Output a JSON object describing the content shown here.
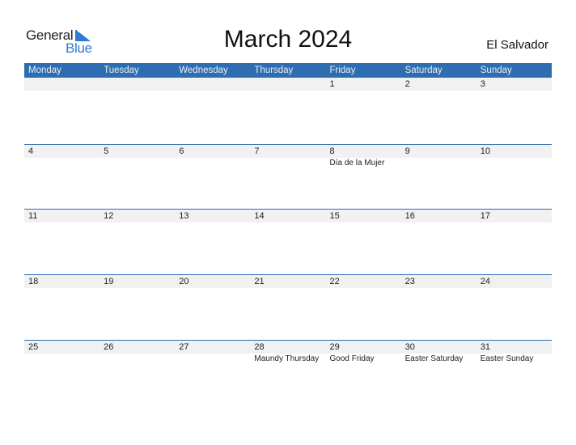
{
  "logo": {
    "line1": "General",
    "line2": "Blue",
    "brand_color": "#2e7bd0"
  },
  "title": "March 2024",
  "country": "El Salvador",
  "header_color": "#2e6db0",
  "weekdays": [
    "Monday",
    "Tuesday",
    "Wednesday",
    "Thursday",
    "Friday",
    "Saturday",
    "Sunday"
  ],
  "weeks": [
    {
      "days": [
        {
          "num": "",
          "holiday": ""
        },
        {
          "num": "",
          "holiday": ""
        },
        {
          "num": "",
          "holiday": ""
        },
        {
          "num": "",
          "holiday": ""
        },
        {
          "num": "1",
          "holiday": ""
        },
        {
          "num": "2",
          "holiday": ""
        },
        {
          "num": "3",
          "holiday": ""
        }
      ]
    },
    {
      "days": [
        {
          "num": "4",
          "holiday": ""
        },
        {
          "num": "5",
          "holiday": ""
        },
        {
          "num": "6",
          "holiday": ""
        },
        {
          "num": "7",
          "holiday": ""
        },
        {
          "num": "8",
          "holiday": "Día de la Mujer"
        },
        {
          "num": "9",
          "holiday": ""
        },
        {
          "num": "10",
          "holiday": ""
        }
      ]
    },
    {
      "days": [
        {
          "num": "11",
          "holiday": ""
        },
        {
          "num": "12",
          "holiday": ""
        },
        {
          "num": "13",
          "holiday": ""
        },
        {
          "num": "14",
          "holiday": ""
        },
        {
          "num": "15",
          "holiday": ""
        },
        {
          "num": "16",
          "holiday": ""
        },
        {
          "num": "17",
          "holiday": ""
        }
      ]
    },
    {
      "days": [
        {
          "num": "18",
          "holiday": ""
        },
        {
          "num": "19",
          "holiday": ""
        },
        {
          "num": "20",
          "holiday": ""
        },
        {
          "num": "21",
          "holiday": ""
        },
        {
          "num": "22",
          "holiday": ""
        },
        {
          "num": "23",
          "holiday": ""
        },
        {
          "num": "24",
          "holiday": ""
        }
      ]
    },
    {
      "days": [
        {
          "num": "25",
          "holiday": ""
        },
        {
          "num": "26",
          "holiday": ""
        },
        {
          "num": "27",
          "holiday": ""
        },
        {
          "num": "28",
          "holiday": "Maundy Thursday"
        },
        {
          "num": "29",
          "holiday": "Good Friday"
        },
        {
          "num": "30",
          "holiday": "Easter Saturday"
        },
        {
          "num": "31",
          "holiday": "Easter Sunday"
        }
      ]
    }
  ]
}
